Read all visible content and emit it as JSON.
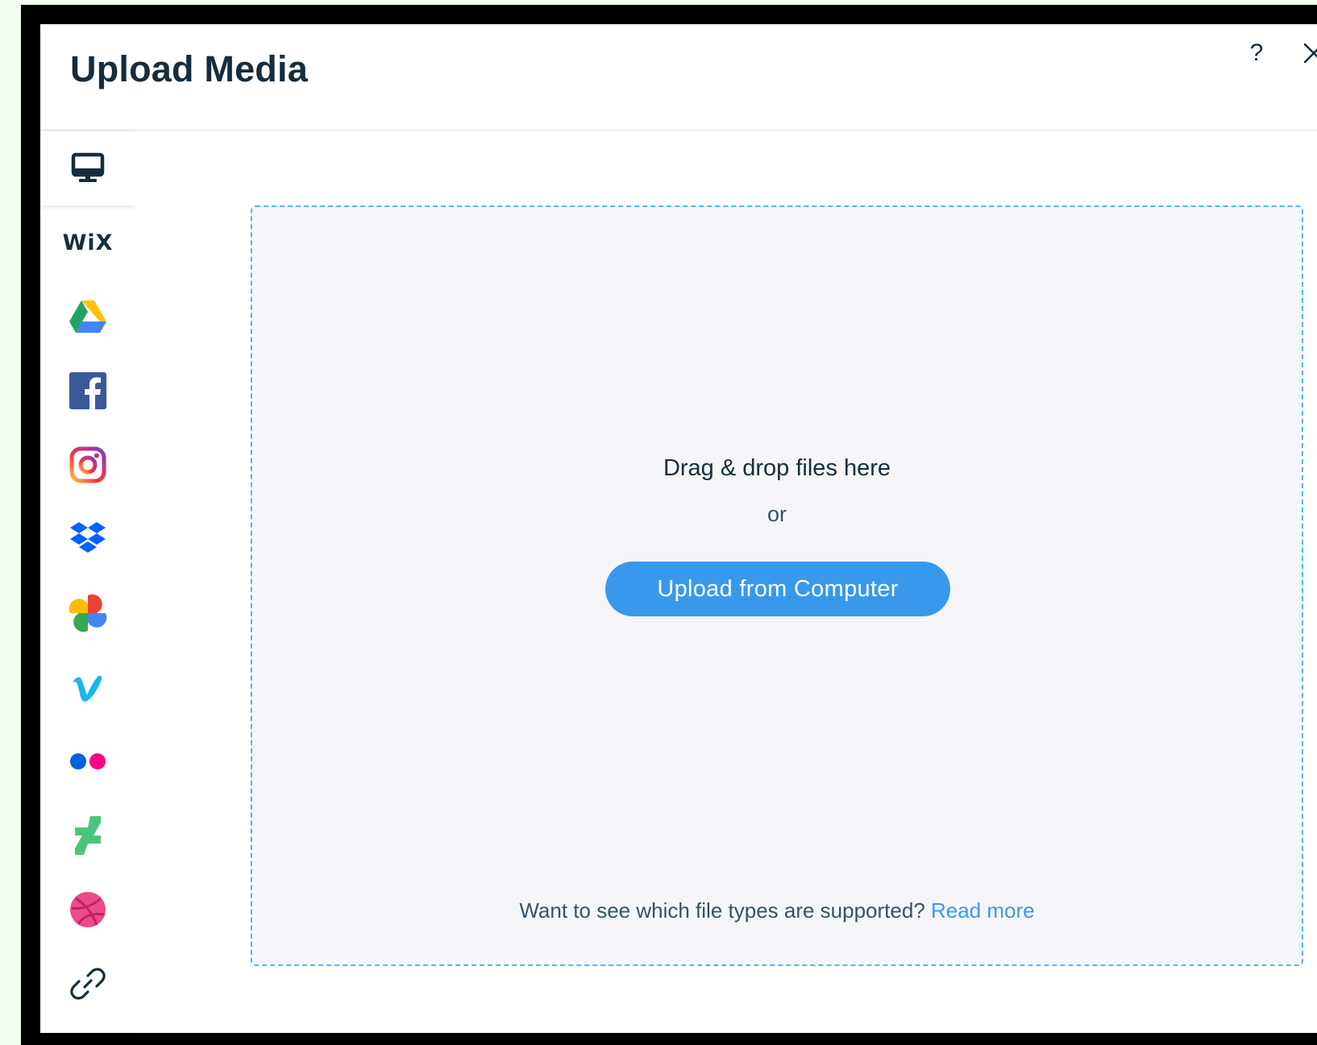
{
  "dialog": {
    "title": "Upload Media",
    "help_label": "?",
    "close_icon": "close-icon"
  },
  "sidebar": {
    "items": [
      {
        "id": "my-computer",
        "icon": "computer-monitor-icon",
        "active": true
      },
      {
        "id": "wix",
        "icon": "wix-logo-icon",
        "label": "WiX"
      },
      {
        "id": "google-drive",
        "icon": "google-drive-icon"
      },
      {
        "id": "facebook",
        "icon": "facebook-icon"
      },
      {
        "id": "instagram",
        "icon": "instagram-icon"
      },
      {
        "id": "dropbox",
        "icon": "dropbox-icon"
      },
      {
        "id": "google-photos",
        "icon": "google-photos-icon"
      },
      {
        "id": "vimeo",
        "icon": "vimeo-icon"
      },
      {
        "id": "flickr",
        "icon": "flickr-icon"
      },
      {
        "id": "deviantart",
        "icon": "deviantart-icon"
      },
      {
        "id": "dribbble",
        "icon": "dribbble-icon"
      },
      {
        "id": "link",
        "icon": "link-icon"
      }
    ]
  },
  "dropzone": {
    "drag_text": "Drag & drop files here",
    "or_text": "or",
    "upload_button_label": "Upload from Computer",
    "footer_text": "Want to see which file types are supported?",
    "read_more_label": "Read more"
  },
  "colors": {
    "accent": "#3899ec",
    "text_primary": "#162d3d",
    "text_secondary": "#32536a",
    "dropzone_bg": "#f6f6fa",
    "dropzone_border": "#4eb7f5"
  }
}
